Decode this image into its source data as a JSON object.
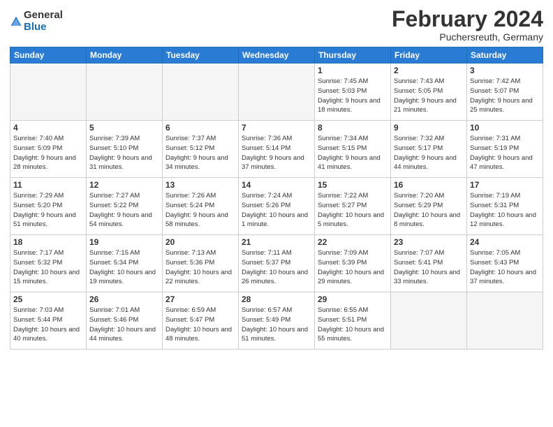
{
  "header": {
    "logo_general": "General",
    "logo_blue": "Blue",
    "month_title": "February 2024",
    "location": "Puchersreuth, Germany"
  },
  "weekdays": [
    "Sunday",
    "Monday",
    "Tuesday",
    "Wednesday",
    "Thursday",
    "Friday",
    "Saturday"
  ],
  "weeks": [
    [
      {
        "day": "",
        "info": ""
      },
      {
        "day": "",
        "info": ""
      },
      {
        "day": "",
        "info": ""
      },
      {
        "day": "",
        "info": ""
      },
      {
        "day": "1",
        "info": "Sunrise: 7:45 AM\nSunset: 5:03 PM\nDaylight: 9 hours\nand 18 minutes."
      },
      {
        "day": "2",
        "info": "Sunrise: 7:43 AM\nSunset: 5:05 PM\nDaylight: 9 hours\nand 21 minutes."
      },
      {
        "day": "3",
        "info": "Sunrise: 7:42 AM\nSunset: 5:07 PM\nDaylight: 9 hours\nand 25 minutes."
      }
    ],
    [
      {
        "day": "4",
        "info": "Sunrise: 7:40 AM\nSunset: 5:09 PM\nDaylight: 9 hours\nand 28 minutes."
      },
      {
        "day": "5",
        "info": "Sunrise: 7:39 AM\nSunset: 5:10 PM\nDaylight: 9 hours\nand 31 minutes."
      },
      {
        "day": "6",
        "info": "Sunrise: 7:37 AM\nSunset: 5:12 PM\nDaylight: 9 hours\nand 34 minutes."
      },
      {
        "day": "7",
        "info": "Sunrise: 7:36 AM\nSunset: 5:14 PM\nDaylight: 9 hours\nand 37 minutes."
      },
      {
        "day": "8",
        "info": "Sunrise: 7:34 AM\nSunset: 5:15 PM\nDaylight: 9 hours\nand 41 minutes."
      },
      {
        "day": "9",
        "info": "Sunrise: 7:32 AM\nSunset: 5:17 PM\nDaylight: 9 hours\nand 44 minutes."
      },
      {
        "day": "10",
        "info": "Sunrise: 7:31 AM\nSunset: 5:19 PM\nDaylight: 9 hours\nand 47 minutes."
      }
    ],
    [
      {
        "day": "11",
        "info": "Sunrise: 7:29 AM\nSunset: 5:20 PM\nDaylight: 9 hours\nand 51 minutes."
      },
      {
        "day": "12",
        "info": "Sunrise: 7:27 AM\nSunset: 5:22 PM\nDaylight: 9 hours\nand 54 minutes."
      },
      {
        "day": "13",
        "info": "Sunrise: 7:26 AM\nSunset: 5:24 PM\nDaylight: 9 hours\nand 58 minutes."
      },
      {
        "day": "14",
        "info": "Sunrise: 7:24 AM\nSunset: 5:26 PM\nDaylight: 10 hours\nand 1 minute."
      },
      {
        "day": "15",
        "info": "Sunrise: 7:22 AM\nSunset: 5:27 PM\nDaylight: 10 hours\nand 5 minutes."
      },
      {
        "day": "16",
        "info": "Sunrise: 7:20 AM\nSunset: 5:29 PM\nDaylight: 10 hours\nand 8 minutes."
      },
      {
        "day": "17",
        "info": "Sunrise: 7:19 AM\nSunset: 5:31 PM\nDaylight: 10 hours\nand 12 minutes."
      }
    ],
    [
      {
        "day": "18",
        "info": "Sunrise: 7:17 AM\nSunset: 5:32 PM\nDaylight: 10 hours\nand 15 minutes."
      },
      {
        "day": "19",
        "info": "Sunrise: 7:15 AM\nSunset: 5:34 PM\nDaylight: 10 hours\nand 19 minutes."
      },
      {
        "day": "20",
        "info": "Sunrise: 7:13 AM\nSunset: 5:36 PM\nDaylight: 10 hours\nand 22 minutes."
      },
      {
        "day": "21",
        "info": "Sunrise: 7:11 AM\nSunset: 5:37 PM\nDaylight: 10 hours\nand 26 minutes."
      },
      {
        "day": "22",
        "info": "Sunrise: 7:09 AM\nSunset: 5:39 PM\nDaylight: 10 hours\nand 29 minutes."
      },
      {
        "day": "23",
        "info": "Sunrise: 7:07 AM\nSunset: 5:41 PM\nDaylight: 10 hours\nand 33 minutes."
      },
      {
        "day": "24",
        "info": "Sunrise: 7:05 AM\nSunset: 5:43 PM\nDaylight: 10 hours\nand 37 minutes."
      }
    ],
    [
      {
        "day": "25",
        "info": "Sunrise: 7:03 AM\nSunset: 5:44 PM\nDaylight: 10 hours\nand 40 minutes."
      },
      {
        "day": "26",
        "info": "Sunrise: 7:01 AM\nSunset: 5:46 PM\nDaylight: 10 hours\nand 44 minutes."
      },
      {
        "day": "27",
        "info": "Sunrise: 6:59 AM\nSunset: 5:47 PM\nDaylight: 10 hours\nand 48 minutes."
      },
      {
        "day": "28",
        "info": "Sunrise: 6:57 AM\nSunset: 5:49 PM\nDaylight: 10 hours\nand 51 minutes."
      },
      {
        "day": "29",
        "info": "Sunrise: 6:55 AM\nSunset: 5:51 PM\nDaylight: 10 hours\nand 55 minutes."
      },
      {
        "day": "",
        "info": ""
      },
      {
        "day": "",
        "info": ""
      }
    ]
  ]
}
